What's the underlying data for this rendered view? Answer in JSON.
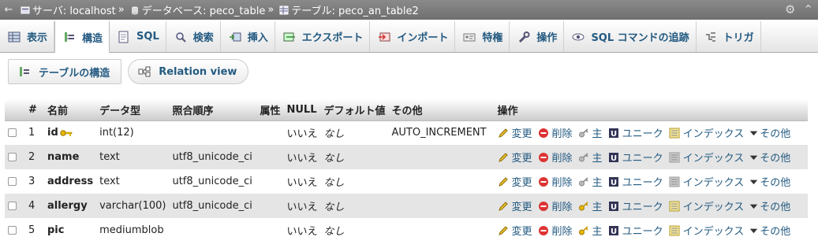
{
  "breadcrumb": {
    "back": "←",
    "server_label": "サーバ: localhost",
    "database_label": "データベース: peco_table",
    "table_label": "テーブル: peco_an_table2",
    "separator": "»"
  },
  "tabs": [
    {
      "label": "表示",
      "icon": "table-icon"
    },
    {
      "label": "構造",
      "icon": "structure-icon",
      "active": true
    },
    {
      "label": "SQL",
      "icon": "sql-icon"
    },
    {
      "label": "検索",
      "icon": "search-icon"
    },
    {
      "label": "挿入",
      "icon": "insert-icon"
    },
    {
      "label": "エクスポート",
      "icon": "export-icon"
    },
    {
      "label": "インポート",
      "icon": "import-icon"
    },
    {
      "label": "特権",
      "icon": "privileges-icon"
    },
    {
      "label": "操作",
      "icon": "wrench-icon"
    },
    {
      "label": "SQL コマンドの追跡",
      "icon": "eye-icon"
    },
    {
      "label": "トリガ",
      "icon": "trigger-icon"
    }
  ],
  "subnav": {
    "structure_label": "テーブルの構造",
    "relation_label": "Relation view"
  },
  "table": {
    "headers": [
      "#",
      "名前",
      "データ型",
      "照合順序",
      "属性",
      "NULL",
      "デフォルト値",
      "その他",
      "操作"
    ],
    "rows": [
      {
        "num": "1",
        "name": "id",
        "primary": true,
        "type": "int(12)",
        "collation": "",
        "attr": "",
        "null": "いいえ",
        "default": "なし",
        "extra": "AUTO_INCREMENT",
        "primary_enabled": false,
        "index_enabled": true
      },
      {
        "num": "2",
        "name": "name",
        "primary": false,
        "type": "text",
        "collation": "utf8_unicode_ci",
        "attr": "",
        "null": "いいえ",
        "default": "なし",
        "extra": "",
        "primary_enabled": false,
        "index_enabled": false
      },
      {
        "num": "3",
        "name": "address",
        "primary": false,
        "type": "text",
        "collation": "utf8_unicode_ci",
        "attr": "",
        "null": "いいえ",
        "default": "なし",
        "extra": "",
        "primary_enabled": false,
        "index_enabled": false
      },
      {
        "num": "4",
        "name": "allergy",
        "primary": false,
        "type": "varchar(100)",
        "collation": "utf8_unicode_ci",
        "attr": "",
        "null": "いいえ",
        "default": "なし",
        "extra": "",
        "primary_enabled": true,
        "index_enabled": true
      },
      {
        "num": "5",
        "name": "pic",
        "primary": false,
        "type": "mediumblob",
        "collation": "",
        "attr": "",
        "null": "いいえ",
        "default": "なし",
        "extra": "",
        "primary_enabled": true,
        "index_enabled": true
      }
    ],
    "actions": {
      "change": "変更",
      "drop": "削除",
      "primary": "主",
      "unique": "ユニーク",
      "index": "インデックス",
      "more": "その他"
    }
  },
  "colors": {
    "link": "#235a81",
    "crumbbar": "#777777",
    "row_even": "#e5e5e5",
    "drop_red": "#d33"
  }
}
